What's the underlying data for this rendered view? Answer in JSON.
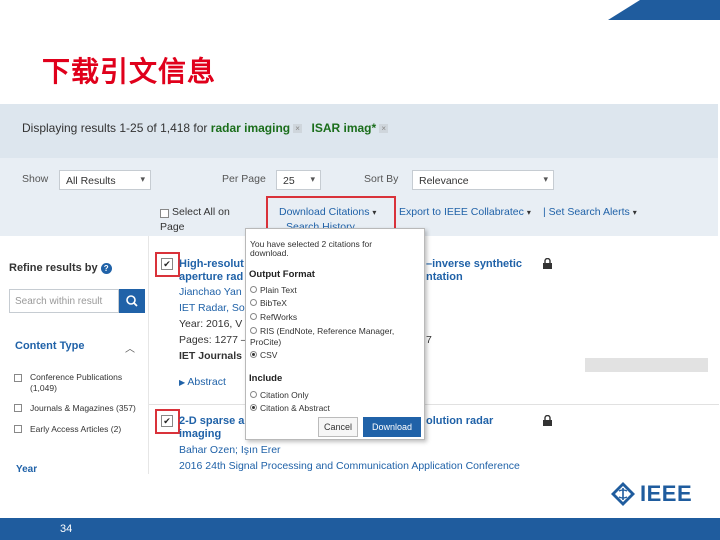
{
  "slide": {
    "title": "下载引文信息",
    "page_number": "34",
    "logo_text": "IEEE"
  },
  "results_bar": {
    "prefix": "Displaying results 1-25 of 1,418 for",
    "keyword1": "radar imaging",
    "keyword2": "ISAR imag*",
    "remove_glyph": "×"
  },
  "controls": {
    "show_label": "Show",
    "show_value": "All Results",
    "per_page_label": "Per Page",
    "per_page_value": "25",
    "sort_label": "Sort By",
    "sort_value": "Relevance",
    "select_all": "Select All on",
    "select_all_cont": "Page",
    "download_citations": "Download Citations",
    "export_collabratec": "Export to IEEE Collabratec",
    "set_alerts": "Set Search Alerts",
    "search_history": "Search History",
    "chevron": "▾"
  },
  "sidebar": {
    "refine_label": "Refine results by",
    "help_glyph": "?",
    "search_placeholder": "Search within result",
    "content_type": "Content Type",
    "facets": [
      {
        "label": "Conference Publications",
        "count": "(1,049)"
      },
      {
        "label": "Journals & Magazines (357)",
        "count": ""
      },
      {
        "label": "Early Access Articles (2)",
        "count": ""
      }
    ],
    "next_heading": "Year"
  },
  "results": [
    {
      "check_glyph": "✔",
      "title_a": "High-resolut",
      "title_a_tail": "–inverse synthetic",
      "title_b": "aperture rad",
      "title_b_tail": "ntation",
      "authors": "Jianchao Yan",
      "venue": "IET Radar, So",
      "year": "Year: 2016, V",
      "pages": "Pages: 1277 –",
      "pages_tail": "7",
      "publisher": "IET Journals",
      "abstract": "Abstract"
    },
    {
      "check_glyph": "✔",
      "title_a": "2-D sparse a",
      "title_a_tail": "olution radar",
      "title_b": "imaging",
      "authors": "Bahar Ozen; Işın Erer",
      "venue": "2016 24th Signal Processing and Communication Application Conference"
    }
  ],
  "popup": {
    "notice_l1": "You have selected 2 citations for",
    "notice_l2": "download.",
    "output_format": "Output Format",
    "formats": [
      "Plain Text",
      "BibTeX",
      "RefWorks",
      "RIS (EndNote, Reference Manager,",
      "ProCite)",
      "CSV"
    ],
    "selected_format": "CSV",
    "include": "Include",
    "include_options": [
      "Citation Only",
      "Citation & Abstract"
    ],
    "cancel": "Cancel",
    "download": "Download"
  },
  "colors": {
    "ieee_blue": "#1f5c9e",
    "title_red": "#e0001b",
    "highlight": "#d9323a",
    "link_blue": "#2062a8"
  }
}
